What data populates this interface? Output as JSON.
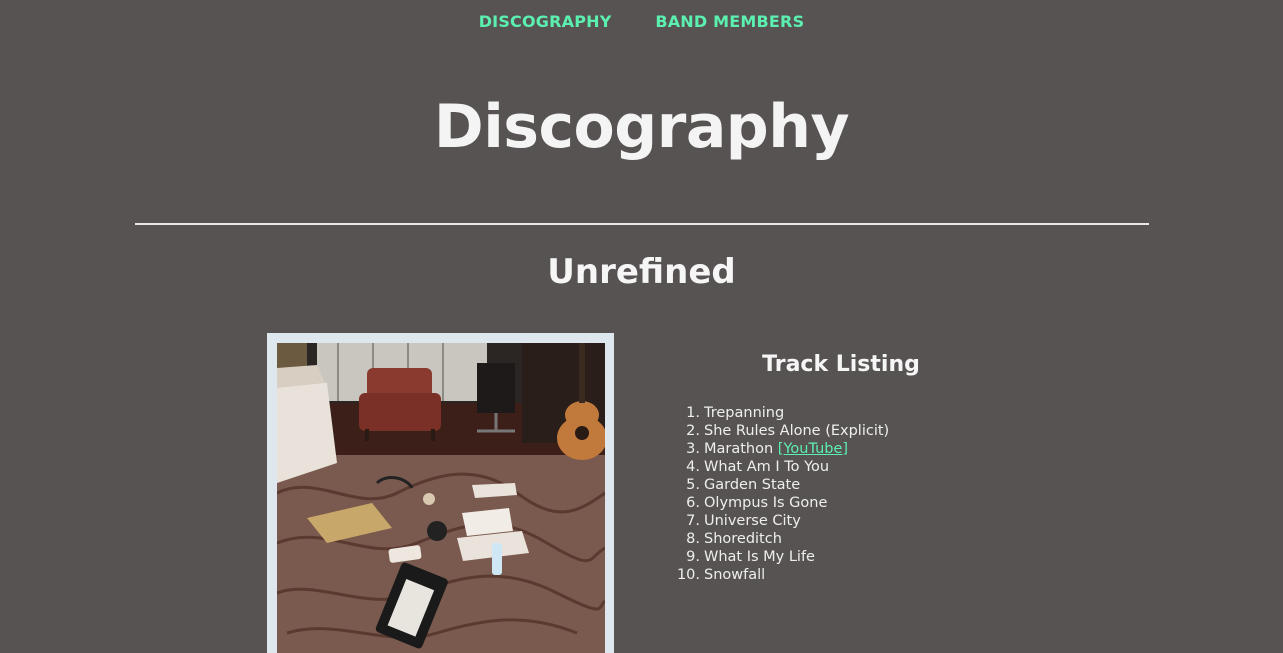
{
  "nav": {
    "items": [
      {
        "label": "DISCOGRAPHY"
      },
      {
        "label": "BAND MEMBERS"
      }
    ],
    "link_color": "#5cf0b0"
  },
  "page": {
    "title": "Discography",
    "background": "#575352"
  },
  "album": {
    "title": "Unrefined",
    "cover_frame_color": "#dfe7ee",
    "track_listing_heading": "Track Listing",
    "tracks": [
      {
        "number": "1.",
        "title": "Trepanning"
      },
      {
        "number": "2.",
        "title": "She Rules Alone (Explicit)"
      },
      {
        "number": "3.",
        "title": "Marathon",
        "link": "[YouTube]"
      },
      {
        "number": "4.",
        "title": "What Am I To You"
      },
      {
        "number": "5.",
        "title": "Garden State"
      },
      {
        "number": "6.",
        "title": "Olympus Is Gone"
      },
      {
        "number": "7.",
        "title": "Universe City"
      },
      {
        "number": "8.",
        "title": "Shoreditch"
      },
      {
        "number": "9.",
        "title": "What Is My Life"
      },
      {
        "number": "10.",
        "title": "Snowfall"
      }
    ]
  }
}
